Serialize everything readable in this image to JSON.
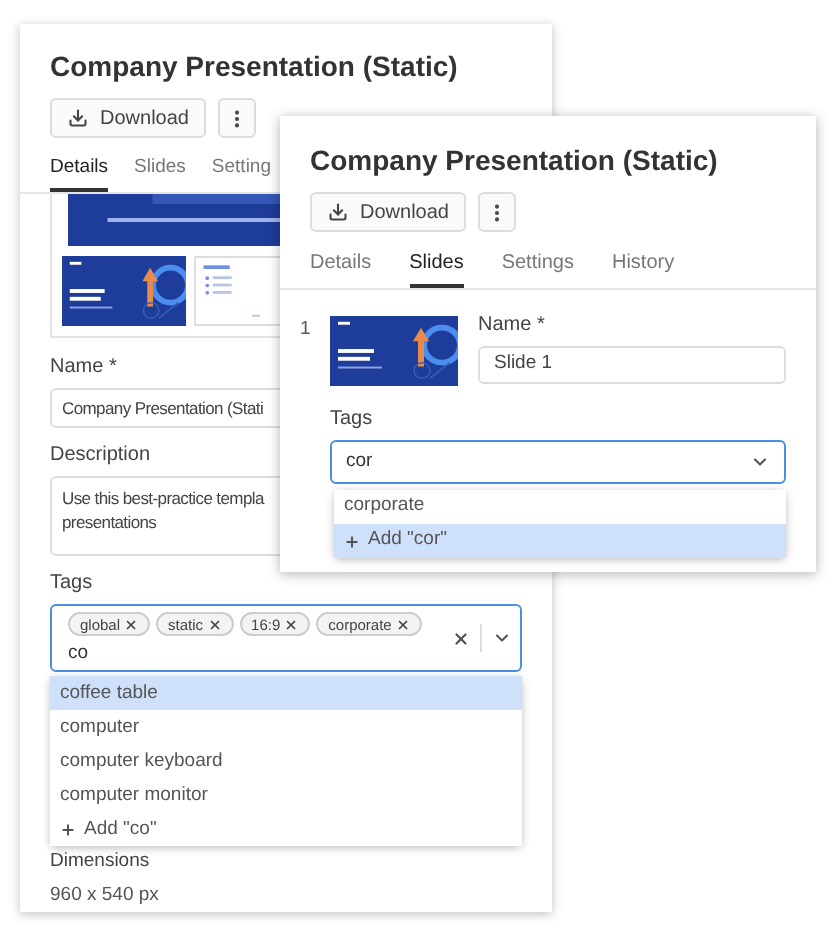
{
  "main_panel": {
    "title": "Company Presentation (Static)",
    "download_label": "Download",
    "tabs": [
      {
        "label": "Details",
        "selected": true
      },
      {
        "label": "Slides",
        "selected": false
      },
      {
        "label": "Setting",
        "selected": false
      }
    ],
    "name_field": {
      "label": "Name *",
      "value": "Company Presentation (Stati"
    },
    "description_field": {
      "label": "Description",
      "value": "Use this best-practice templa\npresentations"
    },
    "tags_field": {
      "label": "Tags",
      "focused": true,
      "chips": [
        "global",
        "static",
        "16:9",
        "corporate"
      ],
      "value": "co"
    },
    "options": [
      {
        "label": "coffee table",
        "kind": "tag",
        "selected": true
      },
      {
        "label": "computer",
        "kind": "tag",
        "selected": false
      },
      {
        "label": "computer keyboard",
        "kind": "tag",
        "selected": false
      },
      {
        "label": "computer monitor",
        "kind": "tag",
        "selected": false
      },
      {
        "label": "Add \"co\"",
        "kind": "add",
        "selected": false
      }
    ],
    "dimensions": {
      "label": "Dimensions",
      "value": "960 x 540 px"
    }
  },
  "slide_panel": {
    "title": "Company Presentation (Static)",
    "download_label": "Download",
    "tabs": [
      {
        "label": "Details",
        "selected": false
      },
      {
        "label": "Slides",
        "selected": true
      },
      {
        "label": "Settings",
        "selected": false
      },
      {
        "label": "History",
        "selected": false
      }
    ],
    "slides": [
      {
        "number": "1",
        "name_label": "Name *",
        "name_value": "Slide 1",
        "tags_label": "Tags",
        "tags_focused": true,
        "tags_value": "cor",
        "options": [
          {
            "label": "corporate",
            "kind": "tag",
            "selected": false
          },
          {
            "label": "Add \"cor\"",
            "kind": "add",
            "selected": true
          }
        ]
      }
    ]
  }
}
